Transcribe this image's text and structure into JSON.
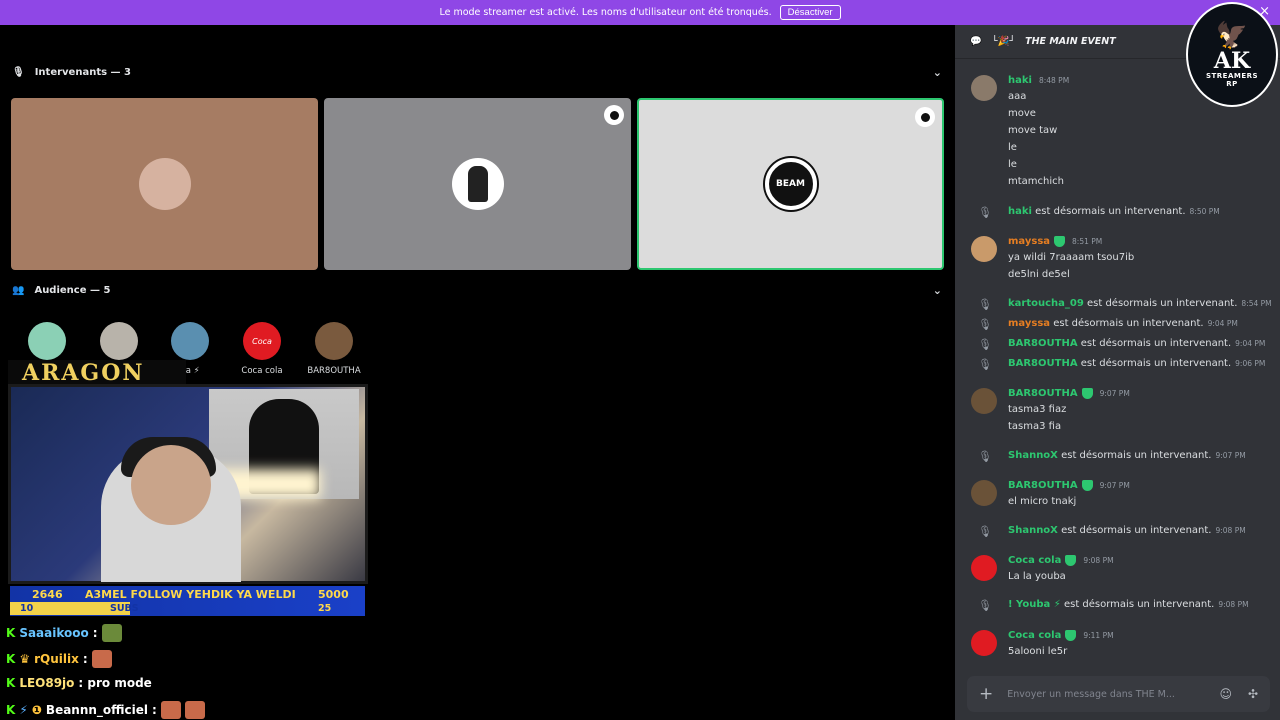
{
  "banner": {
    "text": "Le mode streamer est activé. Les noms d'utilisateur ont été tronqués.",
    "button": "Désactiver",
    "close": "×"
  },
  "stage": {
    "speakers_header": "Intervenants — 3",
    "audience_header": "Audience — 5",
    "speaker_tiles": [
      {
        "bg": "#a67c63",
        "avatar_color": "#d6b2a0",
        "has_badge": false
      },
      {
        "bg": "#8a8a8d",
        "avatar_color": "#ffffff",
        "has_badge": true
      },
      {
        "bg": "#dcdcdc",
        "avatar_color": "#111111",
        "has_badge": true,
        "avatar_text": "BEAM",
        "active_color": "#2dc770"
      }
    ],
    "audience": [
      {
        "name": "",
        "color": "#8bd0b5"
      },
      {
        "name": "",
        "color": "#b8b3aa"
      },
      {
        "name": "ba ⚡",
        "color": "#5a8fb0"
      },
      {
        "name": "Coca cola",
        "color": "#e01b22"
      },
      {
        "name": "BAR8OUTHA",
        "color": "#7a5a3e"
      }
    ]
  },
  "overlay": {
    "title": "ARAGON",
    "ticker_left": "2646",
    "ticker_mid": "A3MEL FOLLOW YEHDIK YA WELDI",
    "ticker_right": "5000",
    "ticker_row2_left": "10",
    "ticker_row2_mid": "SUBS",
    "ticker_row2_right": "25",
    "chat": [
      {
        "user": "Saaaikooo",
        "text": ":",
        "emote": true
      },
      {
        "user": "rQuilix",
        "text": ":",
        "emote": true
      },
      {
        "user": "LEO89jo",
        "text": ": pro mode",
        "emote": false
      },
      {
        "user": "Beannn_officiel",
        "text": ":",
        "emote": true
      }
    ]
  },
  "panel": {
    "channel": "THE MAIN EVENT",
    "messages": [
      {
        "user": "haki",
        "time": "8:48 PM",
        "lines": [
          "aaa",
          "move",
          "move taw",
          "le",
          "le",
          "mtamchich"
        ],
        "color": "#8a7a6a"
      },
      {
        "user": "mayssa",
        "time": "8:51 PM",
        "lines": [
          "ya wildi 7raaaam tsou7ib",
          "de5lni de5el"
        ],
        "color": "#c99a6a"
      },
      {
        "user": "BAR8OUTHA",
        "time": "9:07 PM",
        "lines": [
          "tasma3 fiaz",
          "tasma3 fia"
        ],
        "color": "#6a5238"
      },
      {
        "user": "BAR8OUTHA",
        "time": "9:07 PM",
        "lines": [
          "el micro tnakj"
        ],
        "color": "#6a5238"
      },
      {
        "user": "Coca cola",
        "time": "9:08 PM",
        "lines": [
          "La la youba"
        ],
        "color": "#e01b22"
      },
      {
        "user": "Coca cola",
        "time": "9:11 PM",
        "lines": [
          "5alooni le5r"
        ],
        "color": "#e01b22"
      }
    ],
    "system": [
      {
        "user": "haki",
        "text": "est désormais un intervenant.",
        "time": "8:50 PM"
      },
      {
        "user": "kartoucha_09",
        "text": "est désormais un intervenant.",
        "time": "8:54 PM"
      },
      {
        "user": "mayssa",
        "text": "est désormais un intervenant.",
        "time": "9:04 PM"
      },
      {
        "user": "BAR8OUTHA",
        "text": "est désormais un intervenant.",
        "time": "9:04 PM"
      },
      {
        "user": "BAR8OUTHA",
        "text": "est désormais un intervenant.",
        "time": "9:06 PM"
      },
      {
        "user": "ShannoX",
        "text": "est désormais un intervenant.",
        "time": "9:07 PM"
      },
      {
        "user": "ShannoX",
        "text": "est désormais un intervenant.",
        "time": "9:08 PM"
      },
      {
        "user": "! Youba ⚡",
        "text": "est désormais un intervenant.",
        "time": "9:08 PM"
      }
    ],
    "composer_placeholder": "Envoyer un message dans THE M..."
  },
  "logo": {
    "line1": "AK",
    "line2": "STREAMERS",
    "line3": "RP"
  }
}
